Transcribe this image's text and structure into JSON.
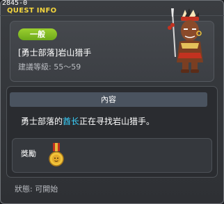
{
  "window": {
    "id_text": "2845-0",
    "title": "QUEST INFO"
  },
  "quest": {
    "category_badge": "一般",
    "name": "[勇士部落]岩山猎手",
    "level_label": "建議等級:",
    "level_range": "55～59"
  },
  "content": {
    "header": "內容",
    "description_before": "勇士部落的",
    "description_highlight": "酋长",
    "description_after": "正在寻找岩山猎手。",
    "highlight_color": "#39d2ff"
  },
  "reward": {
    "label": "獎勵",
    "item_icon": "medal-icon"
  },
  "status": {
    "label": "狀態:",
    "value": "可開始"
  },
  "colors": {
    "title": "#f4d53d",
    "badge": "#8bc425"
  }
}
